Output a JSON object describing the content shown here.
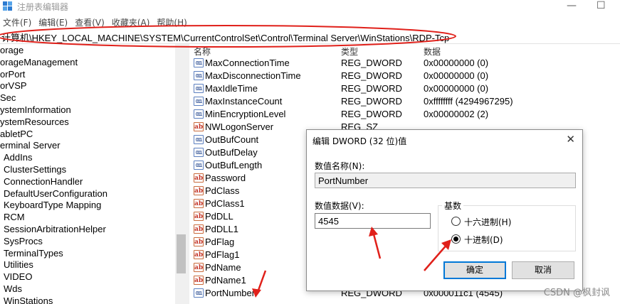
{
  "window": {
    "title": "注册表编辑器",
    "minimize": "—",
    "maximize": "☐"
  },
  "menu": [
    "文件(F)",
    "编辑(E)",
    "查看(V)",
    "收藏夹(A)",
    "帮助(H)"
  ],
  "address": "计算机\\HKEY_LOCAL_MACHINE\\SYSTEM\\CurrentControlSet\\Control\\Terminal Server\\WinStations\\RDP-Tcp",
  "tree": [
    {
      "label": "orage",
      "level": 0
    },
    {
      "label": "orageManagement",
      "level": 0
    },
    {
      "label": "orPort",
      "level": 0
    },
    {
      "label": "orVSP",
      "level": 0
    },
    {
      "label": "Sec",
      "level": 0
    },
    {
      "label": "ystemInformation",
      "level": 0
    },
    {
      "label": "ystemResources",
      "level": 0
    },
    {
      "label": "abletPC",
      "level": 0
    },
    {
      "label": "erminal Server",
      "level": 0
    },
    {
      "label": "AddIns",
      "level": 1
    },
    {
      "label": "ClusterSettings",
      "level": 1
    },
    {
      "label": "ConnectionHandler",
      "level": 1
    },
    {
      "label": "DefaultUserConfiguration",
      "level": 1
    },
    {
      "label": "KeyboardType Mapping",
      "level": 1
    },
    {
      "label": "RCM",
      "level": 1
    },
    {
      "label": "SessionArbitrationHelper",
      "level": 1
    },
    {
      "label": "SysProcs",
      "level": 1
    },
    {
      "label": "TerminalTypes",
      "level": 1
    },
    {
      "label": "Utilities",
      "level": 1
    },
    {
      "label": "VIDEO",
      "level": 1
    },
    {
      "label": "Wds",
      "level": 1
    },
    {
      "label": "WinStations",
      "level": 1
    }
  ],
  "columns": {
    "name": "名称",
    "type": "类型",
    "data": "数据"
  },
  "rows": [
    {
      "icon": "bin",
      "name": "MaxConnectionTime",
      "type": "REG_DWORD",
      "data": "0x00000000 (0)"
    },
    {
      "icon": "bin",
      "name": "MaxDisconnectionTime",
      "type": "REG_DWORD",
      "data": "0x00000000 (0)"
    },
    {
      "icon": "bin",
      "name": "MaxIdleTime",
      "type": "REG_DWORD",
      "data": "0x00000000 (0)"
    },
    {
      "icon": "bin",
      "name": "MaxInstanceCount",
      "type": "REG_DWORD",
      "data": "0xffffffff (4294967295)"
    },
    {
      "icon": "bin",
      "name": "MinEncryptionLevel",
      "type": "REG_DWORD",
      "data": "0x00000002 (2)"
    },
    {
      "icon": "str",
      "name": "NWLogonServer",
      "type": "REG_SZ",
      "data": ""
    },
    {
      "icon": "bin",
      "name": "OutBufCount",
      "type": "",
      "data": ""
    },
    {
      "icon": "bin",
      "name": "OutBufDelay",
      "type": "",
      "data": ""
    },
    {
      "icon": "bin",
      "name": "OutBufLength",
      "type": "",
      "data": ""
    },
    {
      "icon": "str",
      "name": "Password",
      "type": "",
      "data": ""
    },
    {
      "icon": "str",
      "name": "PdClass",
      "type": "",
      "data": ""
    },
    {
      "icon": "str",
      "name": "PdClass1",
      "type": "",
      "data": ""
    },
    {
      "icon": "str",
      "name": "PdDLL",
      "type": "",
      "data": ""
    },
    {
      "icon": "str",
      "name": "PdDLL1",
      "type": "",
      "data": ""
    },
    {
      "icon": "str",
      "name": "PdFlag",
      "type": "",
      "data": ""
    },
    {
      "icon": "str",
      "name": "PdFlag1",
      "type": "",
      "data": ""
    },
    {
      "icon": "str",
      "name": "PdName",
      "type": "",
      "data": ""
    },
    {
      "icon": "str",
      "name": "PdName1",
      "type": "",
      "data": ""
    },
    {
      "icon": "bin",
      "name": "PortNumber",
      "type": "REG_DWORD",
      "data": "0x000011c1 (4545)"
    }
  ],
  "dialog": {
    "title": "编辑 DWORD (32 位)值",
    "close": "✕",
    "name_label": "数值名称(N):",
    "name_value": "PortNumber",
    "data_label": "数值数据(V):",
    "data_value": "4545",
    "base_label": "基数",
    "hex_label": "十六进制(H)",
    "dec_label": "十进制(D)",
    "selected_base": "dec",
    "ok": "确定",
    "cancel": "取消"
  },
  "annotation_color": "#e0201a",
  "watermark": "CSDN @枫封讽"
}
